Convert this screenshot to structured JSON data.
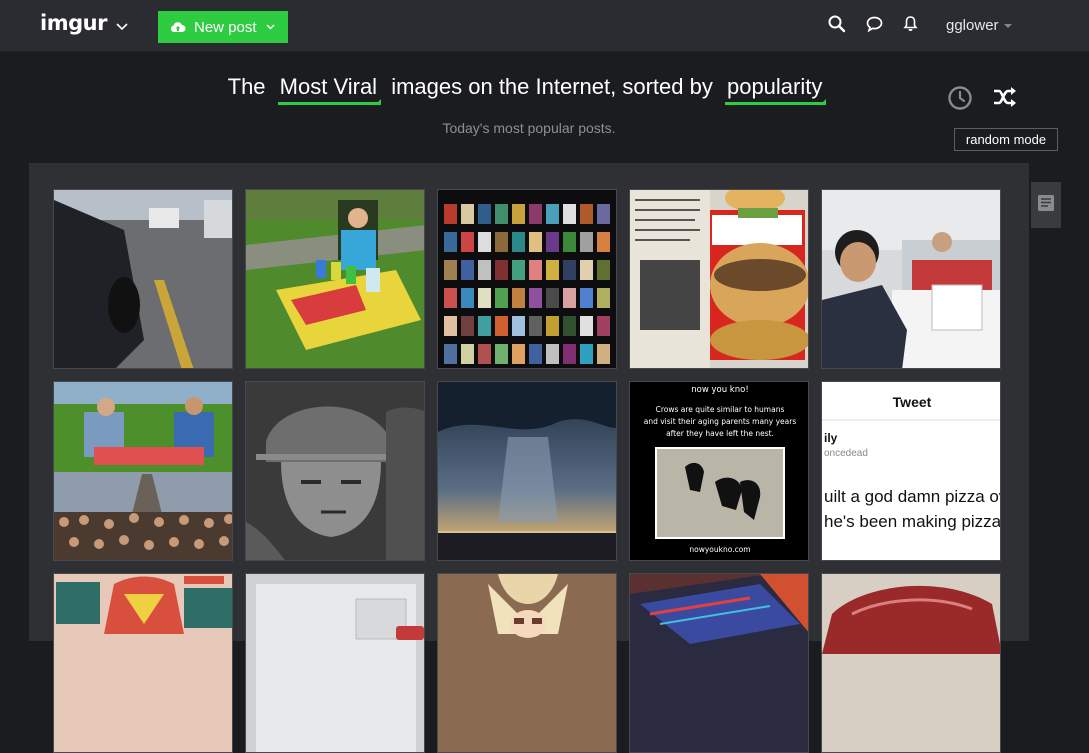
{
  "header": {
    "logo": "imgur",
    "new_post_label": "New post",
    "username": "gglower"
  },
  "hero": {
    "prefix": "The",
    "section": "Most Viral",
    "middle": "images on the Internet, sorted by",
    "sort": "popularity",
    "subtitle": "Today's most popular posts.",
    "tooltip": "random mode"
  },
  "tiles": {
    "t9": {
      "line1": "now you kno!",
      "line2": "Crows are quite similar to humans",
      "line3": "and visit their aging parents many years",
      "line4": "after they have left the nest.",
      "footer": "nowyoukno.com"
    },
    "t10": {
      "title": "Tweet",
      "line1": "ily",
      "line2": "oncedead",
      "line3": "uilt a god damn pizza ov",
      "line4": "he's been making pizza"
    }
  },
  "colors": {
    "accent": "#2ecc40",
    "topbar": "#2b2c31",
    "background": "#1b1c1f"
  }
}
